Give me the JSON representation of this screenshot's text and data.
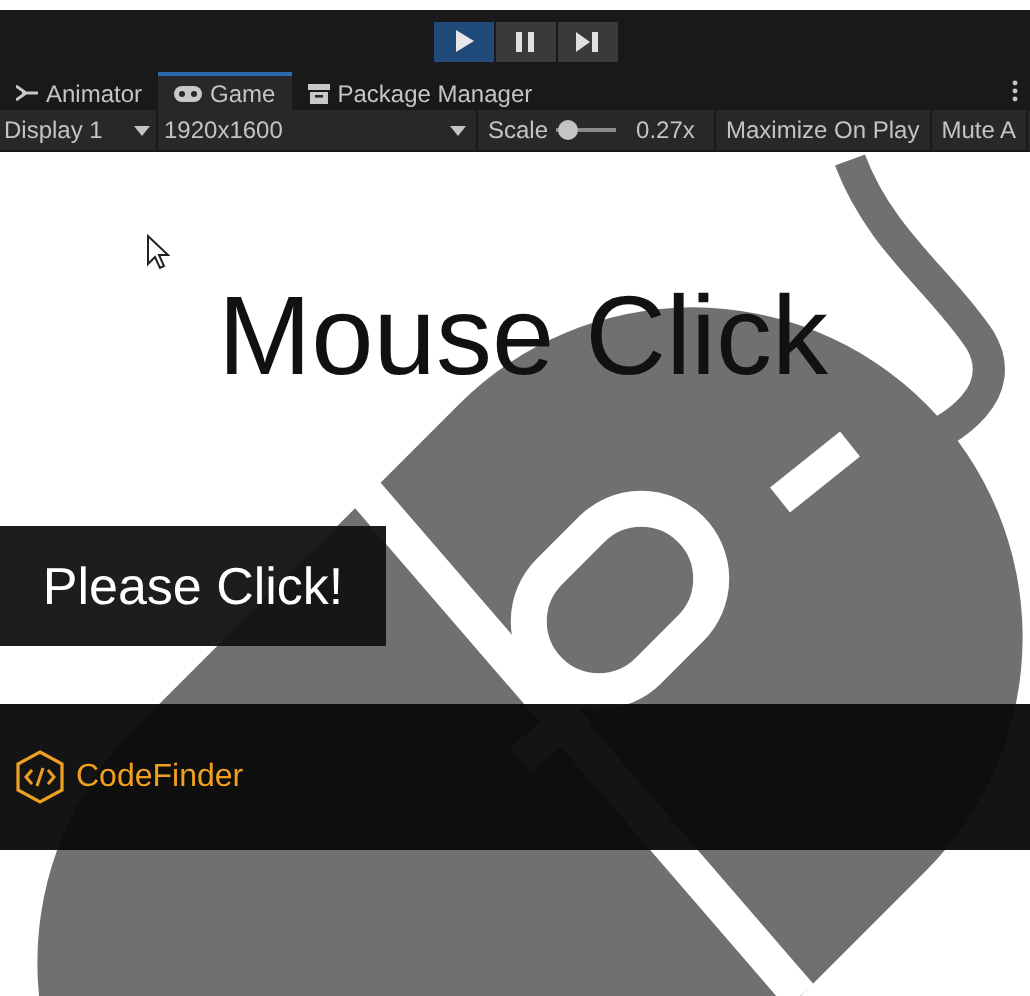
{
  "play_controls": [
    {
      "kind": "play",
      "selected": true
    },
    {
      "kind": "pause",
      "selected": false
    },
    {
      "kind": "step",
      "selected": false
    }
  ],
  "tabs": [
    {
      "label": "Animator",
      "selected": false
    },
    {
      "label": "Game",
      "selected": true
    },
    {
      "label": "Package Manager",
      "selected": false
    }
  ],
  "toolbar": {
    "display": "Display 1",
    "resolution": "1920x1600",
    "scale_label": "Scale",
    "scale": {
      "level": 0.05
    },
    "scale_reading": "0.27x",
    "buttons": [
      "Maximize On Play",
      "Mute A"
    ]
  },
  "game": {
    "title": "Mouse Click",
    "button": "Please Click!",
    "brand": "CodeFinder"
  }
}
